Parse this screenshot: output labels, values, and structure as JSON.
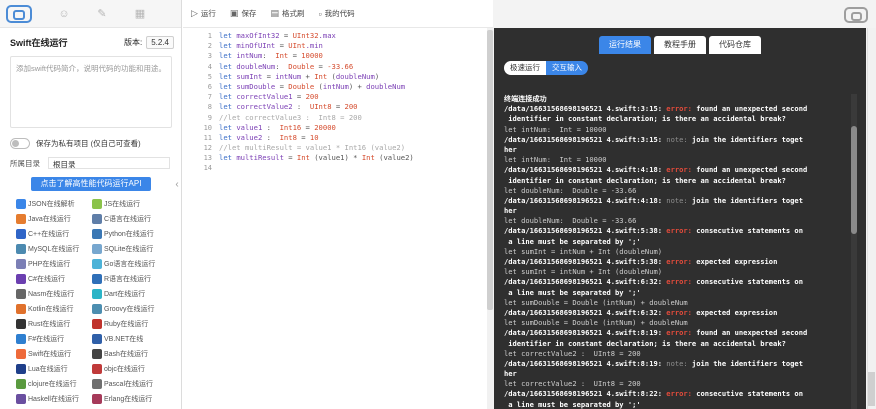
{
  "left": {
    "title": "Swift在线运行",
    "version_label": "版本:",
    "version": "5.2.4",
    "desc_placeholder": "添加swift代码简介，说明代码的功能和用途。",
    "save_label": "保存为私有项目  (仅自己可查看)",
    "dir_label": "所属目录",
    "dir_value": "根目录",
    "api_button": "点击了解高性能代码运行API",
    "langs": [
      {
        "label": "JSON在线解析",
        "color": "#3b86e8"
      },
      {
        "label": "JS在线运行",
        "color": "#8bc34a"
      },
      {
        "label": "Java在线运行",
        "color": "#e57c2f"
      },
      {
        "label": "C语言在线运行",
        "color": "#5f7ea8"
      },
      {
        "label": "C++在线运行",
        "color": "#2f65c7"
      },
      {
        "label": "Python在线运行",
        "color": "#3a77b4"
      },
      {
        "label": "MySQL在线运行",
        "color": "#4c8ab0"
      },
      {
        "label": "SQLite在线运行",
        "color": "#77a7cf"
      },
      {
        "label": "PHP在线运行",
        "color": "#7b7fb5"
      },
      {
        "label": "Go语言在线运行",
        "color": "#4db3d8"
      },
      {
        "label": "C#在线运行",
        "color": "#6b3fb0"
      },
      {
        "label": "R语言在线运行",
        "color": "#2f6fb8"
      },
      {
        "label": "Nasm在线运行",
        "color": "#666666"
      },
      {
        "label": "Dart在线运行",
        "color": "#2bb4c7"
      },
      {
        "label": "Kotlin在线运行",
        "color": "#e0712c"
      },
      {
        "label": "Groovy在线运行",
        "color": "#4c8eb0"
      },
      {
        "label": "Rust在线运行",
        "color": "#333333"
      },
      {
        "label": "Ruby在线运行",
        "color": "#c0332c"
      },
      {
        "label": "F#在线运行",
        "color": "#2e7fd0"
      },
      {
        "label": "VB.NET在线",
        "color": "#2f5fa8"
      },
      {
        "label": "Swift在线运行",
        "color": "#ee6a3a"
      },
      {
        "label": "Bash在线运行",
        "color": "#444444"
      },
      {
        "label": "Lua在线运行",
        "color": "#1f3f8a"
      },
      {
        "label": "objc在线运行",
        "color": "#c03a3a"
      },
      {
        "label": "clojure在线运行",
        "color": "#5a9a3f"
      },
      {
        "label": "Pascal在线运行",
        "color": "#6f6f6f"
      },
      {
        "label": "Haskell在线运行",
        "color": "#6a4fa0"
      },
      {
        "label": "Erlang在线运行",
        "color": "#a63a5a"
      }
    ]
  },
  "toolbar": {
    "run": "运行",
    "save": "保存",
    "format": "格式刷",
    "my_code": "我的代码"
  },
  "editor": {
    "line_numbers": [
      "1",
      "2",
      "3",
      "4",
      "5",
      "6",
      "7",
      "8",
      "9",
      "10",
      "11",
      "12",
      "13",
      "14"
    ]
  },
  "output": {
    "tabs": [
      "运行结果",
      "教程手册",
      "代码仓库"
    ],
    "subtabs": [
      "极速运行",
      "交互输入"
    ],
    "lines": [
      {
        "cls": "b",
        "parts": [
          {
            "t": "终端连接成功",
            "c": ""
          }
        ]
      },
      {
        "cls": "b",
        "parts": [
          {
            "t": "/data/16631568698196521 4.swift:3:15: ",
            "c": ""
          },
          {
            "t": "error:",
            "c": "err"
          },
          {
            "t": " found an unexpected second",
            "c": ""
          }
        ]
      },
      {
        "cls": "b",
        "parts": [
          {
            "t": " identifier in constant declaration; is there an accidental break?",
            "c": ""
          }
        ]
      },
      {
        "cls": "g",
        "parts": [
          {
            "t": "let intNum:  Int = 10000",
            "c": ""
          }
        ]
      },
      {
        "cls": "b",
        "parts": [
          {
            "t": "/data/16631568698196521 4.swift:3:15: ",
            "c": ""
          },
          {
            "t": "note:",
            "c": "note"
          },
          {
            "t": " join the identifiers toget",
            "c": ""
          }
        ]
      },
      {
        "cls": "b",
        "parts": [
          {
            "t": "her",
            "c": ""
          }
        ]
      },
      {
        "cls": "g",
        "parts": [
          {
            "t": "let intNum:  Int = 10000",
            "c": ""
          }
        ]
      },
      {
        "cls": "b",
        "parts": [
          {
            "t": "/data/16631568698196521 4.swift:4:18: ",
            "c": ""
          },
          {
            "t": "error:",
            "c": "err"
          },
          {
            "t": " found an unexpected second",
            "c": ""
          }
        ]
      },
      {
        "cls": "b",
        "parts": [
          {
            "t": " identifier in constant declaration; is there an accidental break?",
            "c": ""
          }
        ]
      },
      {
        "cls": "g",
        "parts": [
          {
            "t": "let doubleNum:  Double = -33.66",
            "c": ""
          }
        ]
      },
      {
        "cls": "b",
        "parts": [
          {
            "t": "/data/16631568698196521 4.swift:4:18: ",
            "c": ""
          },
          {
            "t": "note:",
            "c": "note"
          },
          {
            "t": " join the identifiers toget",
            "c": ""
          }
        ]
      },
      {
        "cls": "b",
        "parts": [
          {
            "t": "her",
            "c": ""
          }
        ]
      },
      {
        "cls": "g",
        "parts": [
          {
            "t": "let doubleNum:  Double = -33.66",
            "c": ""
          }
        ]
      },
      {
        "cls": "b",
        "parts": [
          {
            "t": "/data/16631568698196521 4.swift:5:38: ",
            "c": ""
          },
          {
            "t": "error:",
            "c": "err"
          },
          {
            "t": " consecutive statements on",
            "c": ""
          }
        ]
      },
      {
        "cls": "b",
        "parts": [
          {
            "t": " a line must be separated by ';'",
            "c": ""
          }
        ]
      },
      {
        "cls": "g",
        "parts": [
          {
            "t": "let sumInt = intNum + Int (doubleNum)",
            "c": ""
          }
        ]
      },
      {
        "cls": "b",
        "parts": [
          {
            "t": "/data/16631568698196521 4.swift:5:38: ",
            "c": ""
          },
          {
            "t": "error:",
            "c": "err"
          },
          {
            "t": " expected expression",
            "c": ""
          }
        ]
      },
      {
        "cls": "g",
        "parts": [
          {
            "t": "let sumInt = intNum + Int (doubleNum)",
            "c": ""
          }
        ]
      },
      {
        "cls": "b",
        "parts": [
          {
            "t": "/data/16631568698196521 4.swift:6:32: ",
            "c": ""
          },
          {
            "t": "error:",
            "c": "err"
          },
          {
            "t": " consecutive statements on",
            "c": ""
          }
        ]
      },
      {
        "cls": "b",
        "parts": [
          {
            "t": " a line must be separated by ';'",
            "c": ""
          }
        ]
      },
      {
        "cls": "g",
        "parts": [
          {
            "t": "let sumDouble = Double (intNum) + doubleNum",
            "c": ""
          }
        ]
      },
      {
        "cls": "b",
        "parts": [
          {
            "t": "/data/16631568698196521 4.swift:6:32: ",
            "c": ""
          },
          {
            "t": "error:",
            "c": "err"
          },
          {
            "t": " expected expression",
            "c": ""
          }
        ]
      },
      {
        "cls": "g",
        "parts": [
          {
            "t": "let sumDouble = Double (intNum) + doubleNum",
            "c": ""
          }
        ]
      },
      {
        "cls": "b",
        "parts": [
          {
            "t": "/data/16631568698196521 4.swift:8:19: ",
            "c": ""
          },
          {
            "t": "error:",
            "c": "err"
          },
          {
            "t": " found an unexpected second",
            "c": ""
          }
        ]
      },
      {
        "cls": "b",
        "parts": [
          {
            "t": " identifier in constant declaration; is there an accidental break?",
            "c": ""
          }
        ]
      },
      {
        "cls": "g",
        "parts": [
          {
            "t": "let correctValue2 :  UInt8 = 200",
            "c": ""
          }
        ]
      },
      {
        "cls": "b",
        "parts": [
          {
            "t": "/data/16631568698196521 4.swift:8:19: ",
            "c": ""
          },
          {
            "t": "note:",
            "c": "note"
          },
          {
            "t": " join the identifiers toget",
            "c": ""
          }
        ]
      },
      {
        "cls": "b",
        "parts": [
          {
            "t": "her",
            "c": ""
          }
        ]
      },
      {
        "cls": "g",
        "parts": [
          {
            "t": "let correctValue2 :  UInt8 = 200",
            "c": ""
          }
        ]
      },
      {
        "cls": "b",
        "parts": [
          {
            "t": "/data/16631568698196521 4.swift:8:22: ",
            "c": ""
          },
          {
            "t": "error:",
            "c": "err"
          },
          {
            "t": " consecutive statements on",
            "c": ""
          }
        ]
      },
      {
        "cls": "b",
        "parts": [
          {
            "t": " a line must be separated by ';'",
            "c": ""
          }
        ]
      }
    ]
  },
  "code_lines": [
    [
      {
        "t": "let ",
        "c": "kw"
      },
      {
        "t": "maxOfInt32",
        "c": "vr"
      },
      {
        "t": " = ",
        "c": ""
      },
      {
        "t": "UInt32",
        "c": "ty"
      },
      {
        "t": ".max",
        "c": "vr"
      }
    ],
    [
      {
        "t": "let ",
        "c": "kw"
      },
      {
        "t": "minOfUInt",
        "c": "vr"
      },
      {
        "t": " = ",
        "c": ""
      },
      {
        "t": "UInt",
        "c": "ty"
      },
      {
        "t": ".min",
        "c": "vr"
      }
    ],
    [
      {
        "t": "let ",
        "c": "kw"
      },
      {
        "t": "intNum",
        "c": "vr"
      },
      {
        "t": ":  ",
        "c": ""
      },
      {
        "t": "Int",
        "c": "ty"
      },
      {
        "t": " = ",
        "c": ""
      },
      {
        "t": "10000",
        "c": "nu"
      }
    ],
    [
      {
        "t": "let ",
        "c": "kw"
      },
      {
        "t": "doubleNum",
        "c": "vr"
      },
      {
        "t": ":  ",
        "c": ""
      },
      {
        "t": "Double",
        "c": "ty"
      },
      {
        "t": " = ",
        "c": ""
      },
      {
        "t": "-33.66",
        "c": "nu"
      }
    ],
    [
      {
        "t": "let ",
        "c": "kw"
      },
      {
        "t": "sumInt",
        "c": "vr"
      },
      {
        "t": " = ",
        "c": ""
      },
      {
        "t": "intNum",
        "c": "vr"
      },
      {
        "t": " + ",
        "c": ""
      },
      {
        "t": "Int",
        "c": "ty"
      },
      {
        "t": " (",
        "c": ""
      },
      {
        "t": "doubleNum",
        "c": "vr"
      },
      {
        "t": ")",
        "c": ""
      }
    ],
    [
      {
        "t": "let ",
        "c": "kw"
      },
      {
        "t": "sumDouble",
        "c": "vr"
      },
      {
        "t": " = ",
        "c": ""
      },
      {
        "t": "Double",
        "c": "ty"
      },
      {
        "t": " (",
        "c": ""
      },
      {
        "t": "intNum",
        "c": "vr"
      },
      {
        "t": ") + ",
        "c": ""
      },
      {
        "t": "doubleNum",
        "c": "vr"
      }
    ],
    [
      {
        "t": "let ",
        "c": "kw"
      },
      {
        "t": "correctValue1",
        "c": "vr"
      },
      {
        "t": " = ",
        "c": ""
      },
      {
        "t": "200",
        "c": "nu"
      }
    ],
    [
      {
        "t": "let ",
        "c": "kw"
      },
      {
        "t": "correctValue2",
        "c": "vr"
      },
      {
        "t": " :  ",
        "c": ""
      },
      {
        "t": "UInt8",
        "c": "ty"
      },
      {
        "t": " = ",
        "c": ""
      },
      {
        "t": "200",
        "c": "nu"
      }
    ],
    [
      {
        "t": "//let correctValue3 :  Int8 = 200",
        "c": "cm"
      }
    ],
    [
      {
        "t": "let ",
        "c": "kw"
      },
      {
        "t": "value1",
        "c": "vr"
      },
      {
        "t": " :  ",
        "c": ""
      },
      {
        "t": "Int16",
        "c": "ty"
      },
      {
        "t": " = ",
        "c": ""
      },
      {
        "t": "20000",
        "c": "nu"
      }
    ],
    [
      {
        "t": "let ",
        "c": "kw"
      },
      {
        "t": "value2",
        "c": "vr"
      },
      {
        "t": " :  ",
        "c": ""
      },
      {
        "t": "Int8",
        "c": "ty"
      },
      {
        "t": " = ",
        "c": ""
      },
      {
        "t": "10",
        "c": "nu"
      }
    ],
    [
      {
        "t": "//let multiResult = value1 * Int16 (value2)",
        "c": "cm"
      }
    ],
    [
      {
        "t": "let ",
        "c": "kw"
      },
      {
        "t": "multiResult",
        "c": "vr"
      },
      {
        "t": " = ",
        "c": ""
      },
      {
        "t": "Int",
        "c": "ty"
      },
      {
        "t": " (value1) * ",
        "c": ""
      },
      {
        "t": "Int",
        "c": "ty"
      },
      {
        "t": " (value2)",
        "c": ""
      }
    ],
    [
      {
        "t": "",
        "c": ""
      }
    ]
  ]
}
